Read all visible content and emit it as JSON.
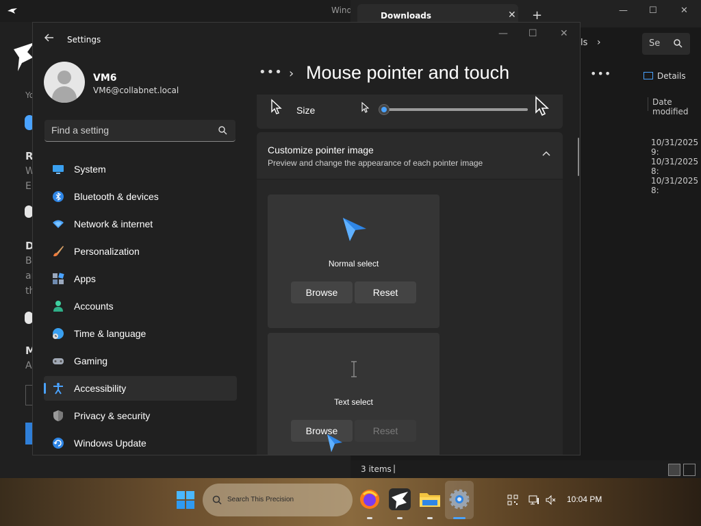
{
  "background_left": {
    "title_fragment": "Wind",
    "texts": [
      "Yo",
      "R",
      "W",
      "Er",
      "D",
      "By",
      "ar",
      "th",
      "M",
      "A"
    ]
  },
  "downloads": {
    "tab_title": "Downloads",
    "search_placeholder": "Se",
    "address_fragment": "ls",
    "details_label": "Details",
    "column_header": "Date modified",
    "dates": [
      "10/31/2025 9:",
      "10/31/2025 8:",
      "10/31/2025 8:"
    ],
    "status_count": "3 items"
  },
  "settings": {
    "title": "Settings",
    "user": {
      "name": "VM6",
      "email": "VM6@collabnet.local"
    },
    "search_placeholder": "Find a setting",
    "nav": [
      {
        "label": "System",
        "icon": "system-icon"
      },
      {
        "label": "Bluetooth & devices",
        "icon": "bluetooth-icon"
      },
      {
        "label": "Network & internet",
        "icon": "wifi-icon"
      },
      {
        "label": "Personalization",
        "icon": "brush-icon"
      },
      {
        "label": "Apps",
        "icon": "apps-icon"
      },
      {
        "label": "Accounts",
        "icon": "accounts-icon"
      },
      {
        "label": "Time & language",
        "icon": "globe-clock-icon"
      },
      {
        "label": "Gaming",
        "icon": "gamepad-icon"
      },
      {
        "label": "Accessibility",
        "icon": "accessibility-icon",
        "selected": true
      },
      {
        "label": "Privacy & security",
        "icon": "shield-icon"
      },
      {
        "label": "Windows Update",
        "icon": "update-icon"
      }
    ],
    "breadcrumb_more": "•••",
    "page_title": "Mouse pointer and touch",
    "size": {
      "label": "Size",
      "value_fraction": 0.0
    },
    "customize": {
      "title": "Customize pointer image",
      "description": "Preview and change the appearance of each pointer image"
    },
    "pointers": [
      {
        "name": "Normal select",
        "browse": "Browse",
        "reset": "Reset",
        "reset_enabled": true
      },
      {
        "name": "Text select",
        "browse": "Browse",
        "reset": "Reset",
        "reset_enabled": false
      }
    ]
  },
  "taskbar": {
    "search_placeholder": "Search This Precision",
    "clock": "10:04 PM",
    "accent": "#4aa3ff"
  }
}
